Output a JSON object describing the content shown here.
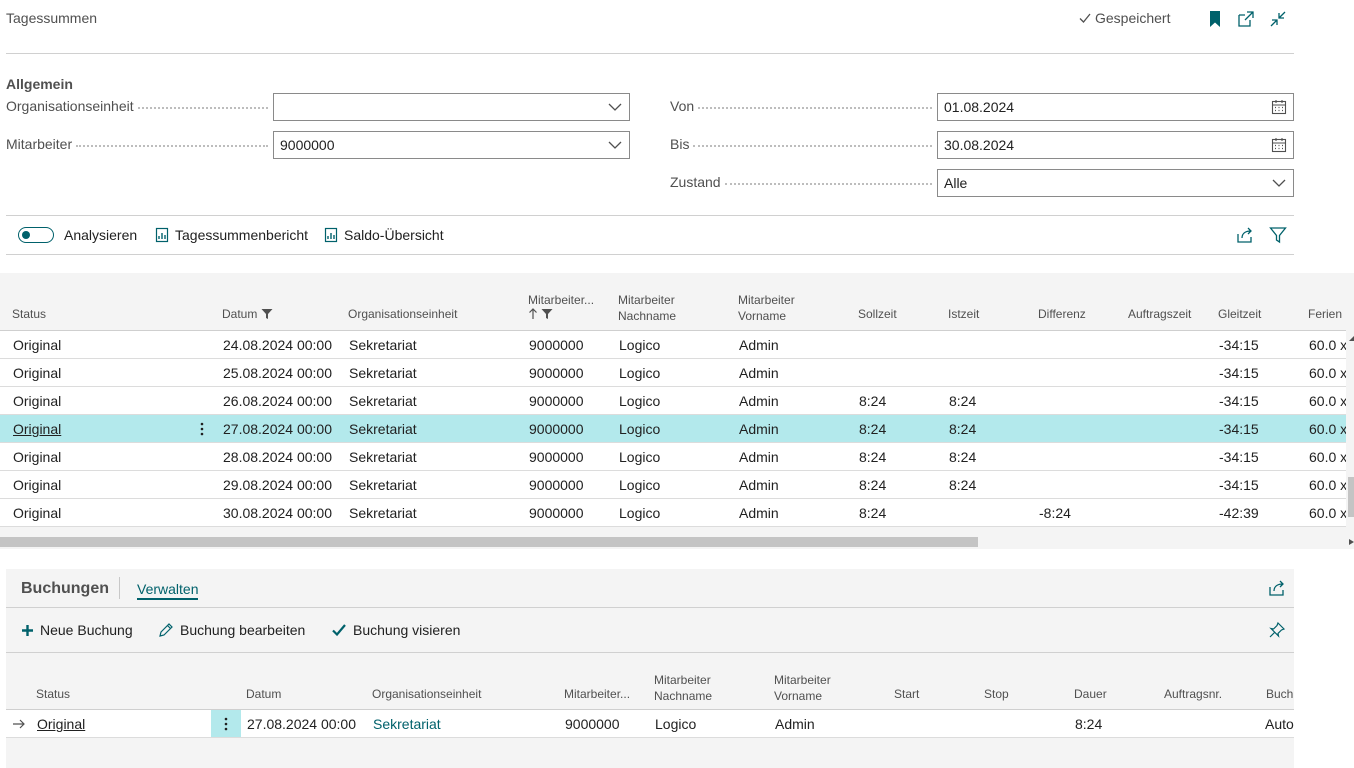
{
  "page": {
    "title": "Tagessummen",
    "saved_label": "Gespeichert"
  },
  "general": {
    "section_title": "Allgemein",
    "org_unit": {
      "label": "Organisationseinheit",
      "value": ""
    },
    "employee": {
      "label": "Mitarbeiter",
      "value": "9000000"
    },
    "from": {
      "label": "Von",
      "value": "01.08.2024"
    },
    "to": {
      "label": "Bis",
      "value": "30.08.2024"
    },
    "state": {
      "label": "Zustand",
      "value": "Alle"
    }
  },
  "actions": {
    "analyze": "Analysieren",
    "daily_report": "Tagessummenbericht",
    "balance_overview": "Saldo-Übersicht"
  },
  "grid": {
    "columns": {
      "status": "Status",
      "date": "Datum",
      "org_unit": "Organisationseinheit",
      "employee_no": "Mitarbeiter...",
      "last_name_1": "Mitarbeiter",
      "last_name_2": "Nachname",
      "first_name_1": "Mitarbeiter",
      "first_name_2": "Vorname",
      "target_time": "Sollzeit",
      "actual_time": "Istzeit",
      "difference": "Differenz",
      "order_time": "Auftragszeit",
      "flextime": "Gleitzeit",
      "vacation": "Ferien"
    },
    "rows": [
      {
        "status": "Original",
        "date": "24.08.2024 00:00",
        "org": "Sekretariat",
        "emp": "9000000",
        "last": "Logico",
        "first": "Admin",
        "target": "",
        "actual": "",
        "diff": "",
        "order": "",
        "flex": "-34:15",
        "vac": "60.0 x"
      },
      {
        "status": "Original",
        "date": "25.08.2024 00:00",
        "org": "Sekretariat",
        "emp": "9000000",
        "last": "Logico",
        "first": "Admin",
        "target": "",
        "actual": "",
        "diff": "",
        "order": "",
        "flex": "-34:15",
        "vac": "60.0 x"
      },
      {
        "status": "Original",
        "date": "26.08.2024 00:00",
        "org": "Sekretariat",
        "emp": "9000000",
        "last": "Logico",
        "first": "Admin",
        "target": "8:24",
        "actual": "8:24",
        "diff": "",
        "order": "",
        "flex": "-34:15",
        "vac": "60.0 x"
      },
      {
        "status": "Original",
        "date": "27.08.2024 00:00",
        "org": "Sekretariat",
        "emp": "9000000",
        "last": "Logico",
        "first": "Admin",
        "target": "8:24",
        "actual": "8:24",
        "diff": "",
        "order": "",
        "flex": "-34:15",
        "vac": "60.0 x"
      },
      {
        "status": "Original",
        "date": "28.08.2024 00:00",
        "org": "Sekretariat",
        "emp": "9000000",
        "last": "Logico",
        "first": "Admin",
        "target": "8:24",
        "actual": "8:24",
        "diff": "",
        "order": "",
        "flex": "-34:15",
        "vac": "60.0 x"
      },
      {
        "status": "Original",
        "date": "29.08.2024 00:00",
        "org": "Sekretariat",
        "emp": "9000000",
        "last": "Logico",
        "first": "Admin",
        "target": "8:24",
        "actual": "8:24",
        "diff": "",
        "order": "",
        "flex": "-34:15",
        "vac": "60.0 x"
      },
      {
        "status": "Original",
        "date": "30.08.2024 00:00",
        "org": "Sekretariat",
        "emp": "9000000",
        "last": "Logico",
        "first": "Admin",
        "target": "8:24",
        "actual": "",
        "diff": "-8:24",
        "order": "",
        "flex": "-42:39",
        "vac": "60.0 x"
      }
    ]
  },
  "bookings": {
    "title": "Buchungen",
    "tab_manage": "Verwalten",
    "actions": {
      "new": "Neue Buchung",
      "edit": "Buchung bearbeiten",
      "approve": "Buchung visieren"
    },
    "columns": {
      "status": "Status",
      "date": "Datum",
      "org_unit": "Organisationseinheit",
      "employee_no": "Mitarbeiter...",
      "last_name_1": "Mitarbeiter",
      "last_name_2": "Nachname",
      "first_name_1": "Mitarbeiter",
      "first_name_2": "Vorname",
      "start": "Start",
      "stop": "Stop",
      "duration": "Dauer",
      "order_no": "Auftragsnr.",
      "booking": "Buchı"
    },
    "rows": [
      {
        "status": "Original",
        "date": "27.08.2024 00:00",
        "org": "Sekretariat",
        "emp": "9000000",
        "last": "Logico",
        "first": "Admin",
        "start": "",
        "stop": "",
        "duration": "8:24",
        "order": "",
        "booking": "Auto"
      }
    ]
  },
  "colors": {
    "accent": "#00616b",
    "selected_row": "#b3e9ec",
    "panel_bg": "#f4f4f4"
  }
}
